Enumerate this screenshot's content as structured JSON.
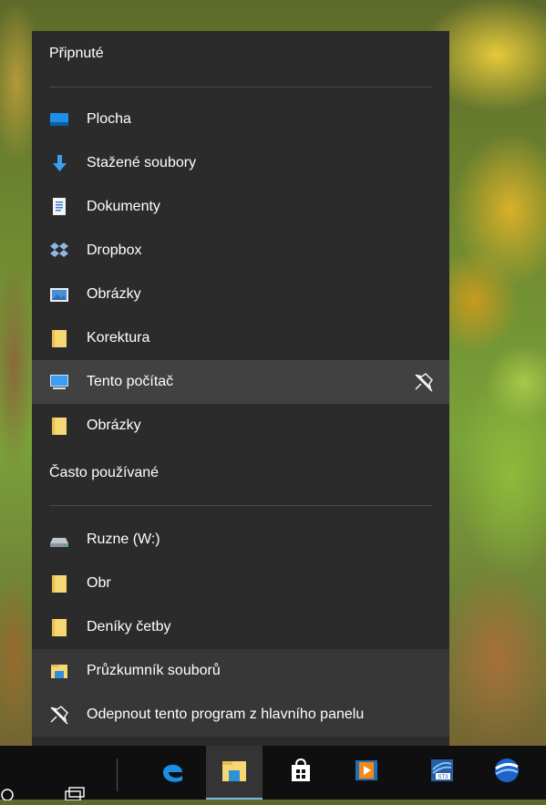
{
  "jumplist": {
    "pinned_header": "Připnuté",
    "pinned_items": [
      {
        "label": "Plocha",
        "icon": "desktop-icon"
      },
      {
        "label": "Stažené soubory",
        "icon": "download-arrow-icon"
      },
      {
        "label": "Dokumenty",
        "icon": "document-icon"
      },
      {
        "label": "Dropbox",
        "icon": "dropbox-icon"
      },
      {
        "label": "Obrázky",
        "icon": "pictures-icon"
      },
      {
        "label": "Korektura",
        "icon": "folder-icon"
      },
      {
        "label": "Tento počítač",
        "icon": "computer-icon"
      },
      {
        "label": "Obrázky",
        "icon": "folder-icon"
      }
    ],
    "frequent_header": "Často používané",
    "frequent_items": [
      {
        "label": "Ruzne (W:)",
        "icon": "drive-icon"
      },
      {
        "label": "Obr",
        "icon": "folder-icon"
      },
      {
        "label": "Deníky četby",
        "icon": "folder-icon"
      }
    ],
    "app_item": {
      "label": "Průzkumník souborů",
      "icon": "file-explorer-icon"
    },
    "unpin_item": {
      "label": "Odepnout tento program z hlavního panelu",
      "icon": "unpin-icon"
    }
  },
  "taskbar": {
    "buttons": [
      "edge-icon",
      "file-explorer-icon",
      "store-icon",
      "media-player-icon",
      "st3-app-icon",
      "google-earth-icon"
    ]
  },
  "colors": {
    "menu_bg": "#2b2b2b",
    "hover_bg": "#414141",
    "accent": "#76b9ed",
    "folder_yellow": "#f7d774"
  }
}
